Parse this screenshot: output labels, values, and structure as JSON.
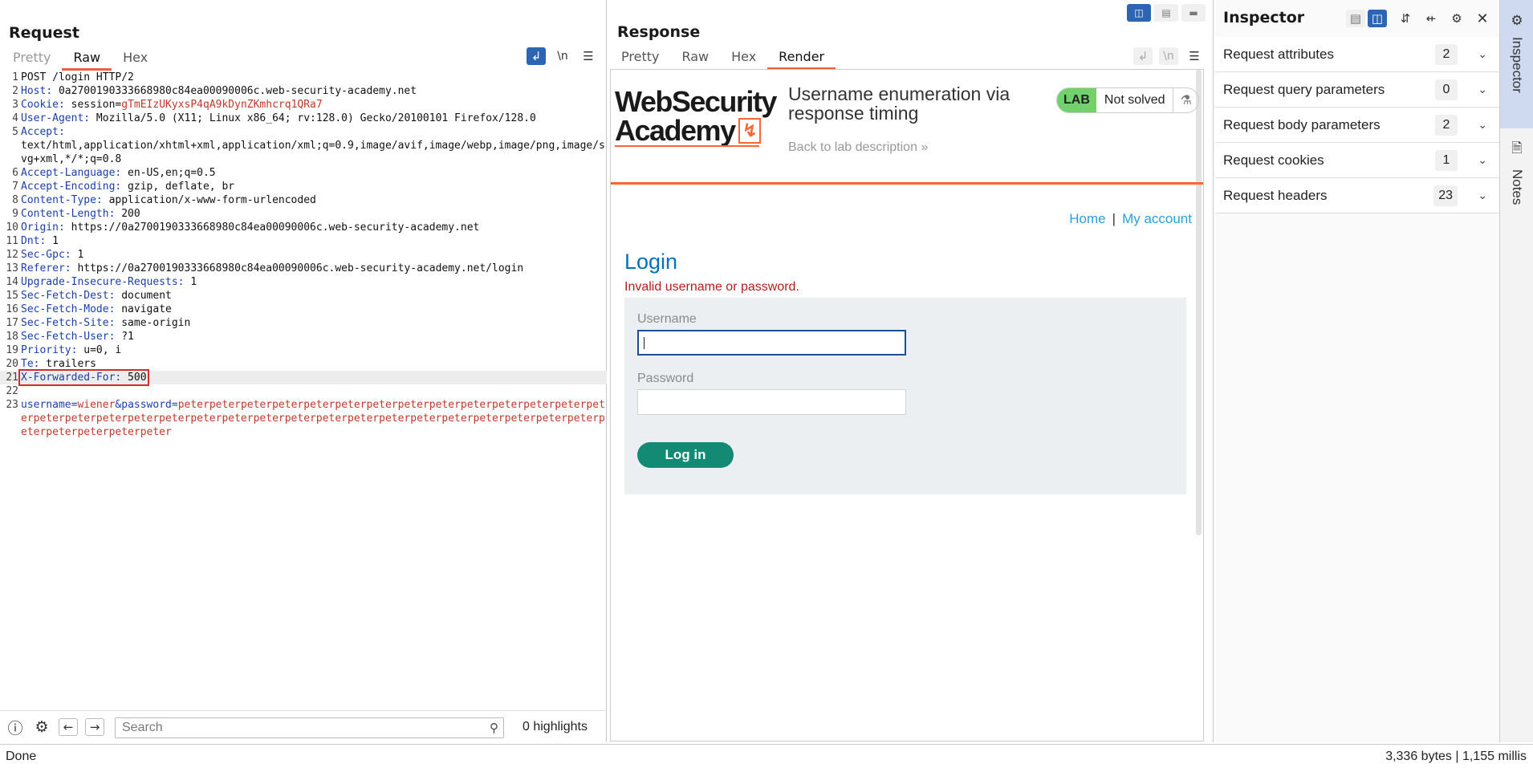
{
  "request": {
    "title": "Request",
    "tabs": [
      "Pretty",
      "Raw",
      "Hex"
    ],
    "lines": [
      {
        "n": "1",
        "name": "",
        "value": "POST /login HTTP/2"
      },
      {
        "n": "2",
        "name": "Host",
        "value": " 0a2700190333668980c84ea00090006c.web-security-academy.net"
      },
      {
        "n": "3",
        "name": "Cookie",
        "value": " session=",
        "extra": "gTmEIzUKyxsP4qA9kDynZKmhcrq1QRa7"
      },
      {
        "n": "4",
        "name": "User-Agent",
        "value": " Mozilla/5.0 (X11; Linux x86_64; rv:128.0) Gecko/20100101 Firefox/128.0"
      },
      {
        "n": "5",
        "name": "Accept",
        "value": "\ntext/html,application/xhtml+xml,application/xml;q=0.9,image/avif,image/webp,image/png,image/svg+xml,*/*;q=0.8"
      },
      {
        "n": "6",
        "name": "Accept-Language",
        "value": " en-US,en;q=0.5"
      },
      {
        "n": "7",
        "name": "Accept-Encoding",
        "value": " gzip, deflate, br"
      },
      {
        "n": "8",
        "name": "Content-Type",
        "value": " application/x-www-form-urlencoded"
      },
      {
        "n": "9",
        "name": "Content-Length",
        "value": " 200"
      },
      {
        "n": "10",
        "name": "Origin",
        "value": " https://0a2700190333668980c84ea00090006c.web-security-academy.net"
      },
      {
        "n": "11",
        "name": "Dnt",
        "value": " 1"
      },
      {
        "n": "12",
        "name": "Sec-Gpc",
        "value": " 1"
      },
      {
        "n": "13",
        "name": "Referer",
        "value": " https://0a2700190333668980c84ea00090006c.web-security-academy.net/login"
      },
      {
        "n": "14",
        "name": "Upgrade-Insecure-Requests",
        "value": " 1"
      },
      {
        "n": "15",
        "name": "Sec-Fetch-Dest",
        "value": " document"
      },
      {
        "n": "16",
        "name": "Sec-Fetch-Mode",
        "value": " navigate"
      },
      {
        "n": "17",
        "name": "Sec-Fetch-Site",
        "value": " same-origin"
      },
      {
        "n": "18",
        "name": "Sec-Fetch-User",
        "value": " ?1"
      },
      {
        "n": "19",
        "name": "Priority",
        "value": " u=0, i"
      },
      {
        "n": "20",
        "name": "Te",
        "value": " trailers"
      },
      {
        "n": "21",
        "name": "X-Forwarded-For",
        "value": " 500",
        "highlight": true
      },
      {
        "n": "22",
        "name": "",
        "value": ""
      }
    ],
    "body_line_number": "23",
    "body_user_name": "username",
    "body_user_value": "wiener",
    "body_amp": "&",
    "body_pass_name": "password",
    "body_pass_value": "peterpeterpeterpeterpeterpeterpeterpeterpeterpeterpeterpeterpeterpeterpeterpeterpeterpeterpeterpeterpeterpeterpeterpeterpeterpeterpeterpeterpeterpeterpeterpeterpeterpeterpeterpeterpeter",
    "search_placeholder": "Search",
    "highlights": "0 highlights"
  },
  "response": {
    "title": "Response",
    "tabs": [
      "Pretty",
      "Raw",
      "Hex",
      "Render"
    ],
    "render": {
      "logo_line1": "WebSecurity",
      "logo_line2": "Academy",
      "lab_title": "Username enumeration via response timing",
      "back_link": "Back to lab description",
      "lab_badge": "LAB",
      "lab_status": "Not solved",
      "nav_home": "Home",
      "nav_sep": "|",
      "nav_account": "My account",
      "heading": "Login",
      "error": "Invalid username or password.",
      "username_label": "Username",
      "password_label": "Password",
      "login_button": "Log in"
    }
  },
  "inspector": {
    "title": "Inspector",
    "rows": [
      {
        "label": "Request attributes",
        "count": "2"
      },
      {
        "label": "Request query parameters",
        "count": "0"
      },
      {
        "label": "Request body parameters",
        "count": "2"
      },
      {
        "label": "Request cookies",
        "count": "1"
      },
      {
        "label": "Request headers",
        "count": "23"
      }
    ]
  },
  "rail": {
    "inspector": "Inspector",
    "notes": "Notes"
  },
  "status": {
    "left": "Done",
    "right": "3,336 bytes | 1,155 millis"
  }
}
